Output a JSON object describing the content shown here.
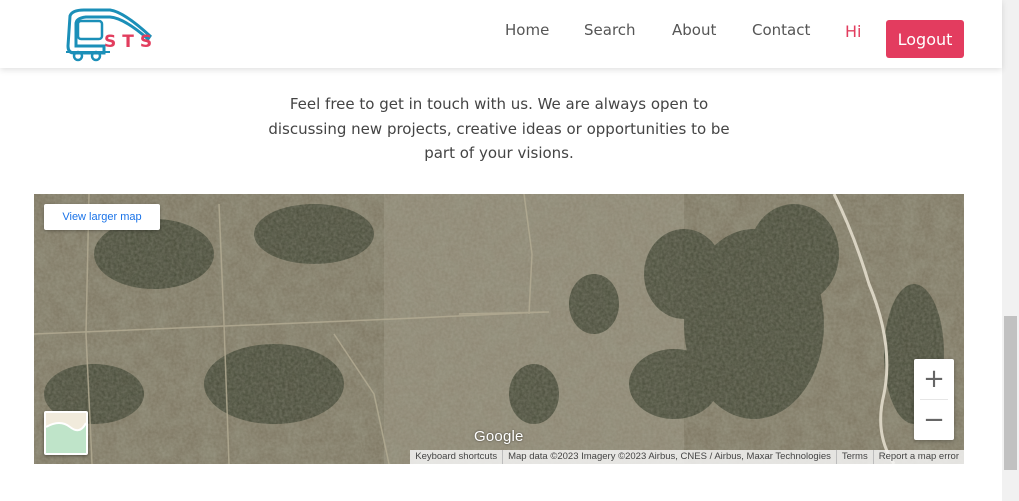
{
  "brand": {
    "logo_text": "STS",
    "logo_icon": "bus-icon"
  },
  "nav": {
    "items": [
      {
        "label": "Home"
      },
      {
        "label": "Search"
      },
      {
        "label": "About"
      },
      {
        "label": "Contact"
      }
    ],
    "greeting": "Hi",
    "logout_label": "Logout"
  },
  "contact": {
    "intro": "Feel free to get in touch with us. We are always open to discussing new projects, creative ideas or opportunities to be part of your visions."
  },
  "map": {
    "view_larger_label": "View larger map",
    "zoom_in_label": "+",
    "zoom_out_label": "−",
    "brand_label": "Google",
    "attribution": {
      "keyboard_shortcuts": "Keyboard shortcuts",
      "map_data": "Map data ©2023 Imagery ©2023 Airbus, CNES / Airbus, Maxar Technologies",
      "terms": "Terms",
      "report": "Report a map error"
    },
    "layer_toggle_icon": "map-layer-icon"
  },
  "colors": {
    "accent": "#e33c5f",
    "logo_blue": "#1b8fb8",
    "nav_text": "#555555",
    "body_text": "#444444"
  }
}
